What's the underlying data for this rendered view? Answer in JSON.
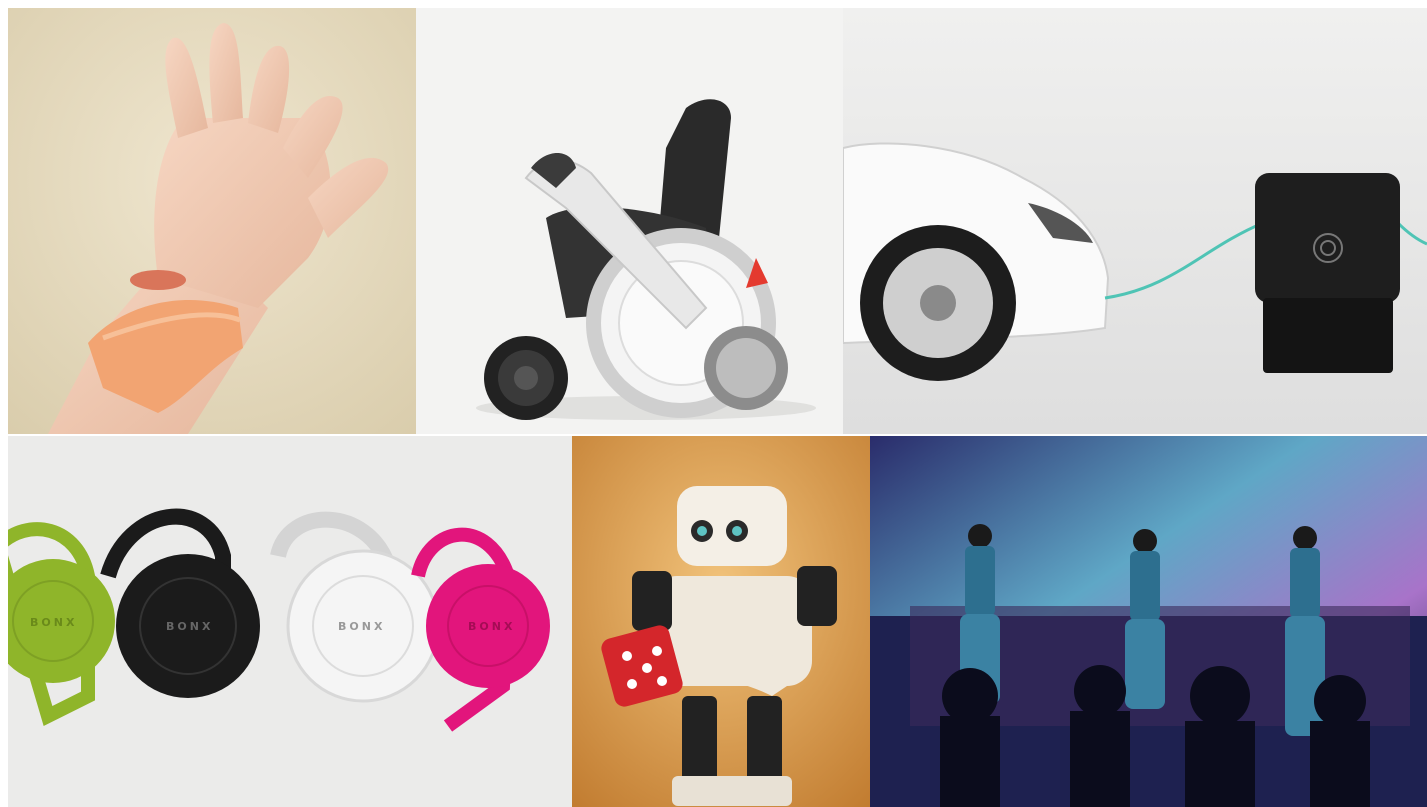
{
  "collage": {
    "tiles": [
      {
        "subject": "hand-with-wristband"
      },
      {
        "subject": "personal-mobility-wheelchair"
      },
      {
        "subject": "car-with-obd-connector"
      },
      {
        "subject": "earpiece-devices"
      },
      {
        "subject": "humanoid-robot-with-dice"
      },
      {
        "subject": "dancers-on-stage"
      }
    ]
  },
  "earpieces": {
    "brand_label": "BONX",
    "colors": [
      "#8fb52a",
      "#1b1b1b",
      "#e6e6e6",
      "#e2157c"
    ]
  },
  "colors": {
    "wristband": "#f2a472",
    "stage_light": "#7cc6d9",
    "cable": "#4fc4b5"
  }
}
